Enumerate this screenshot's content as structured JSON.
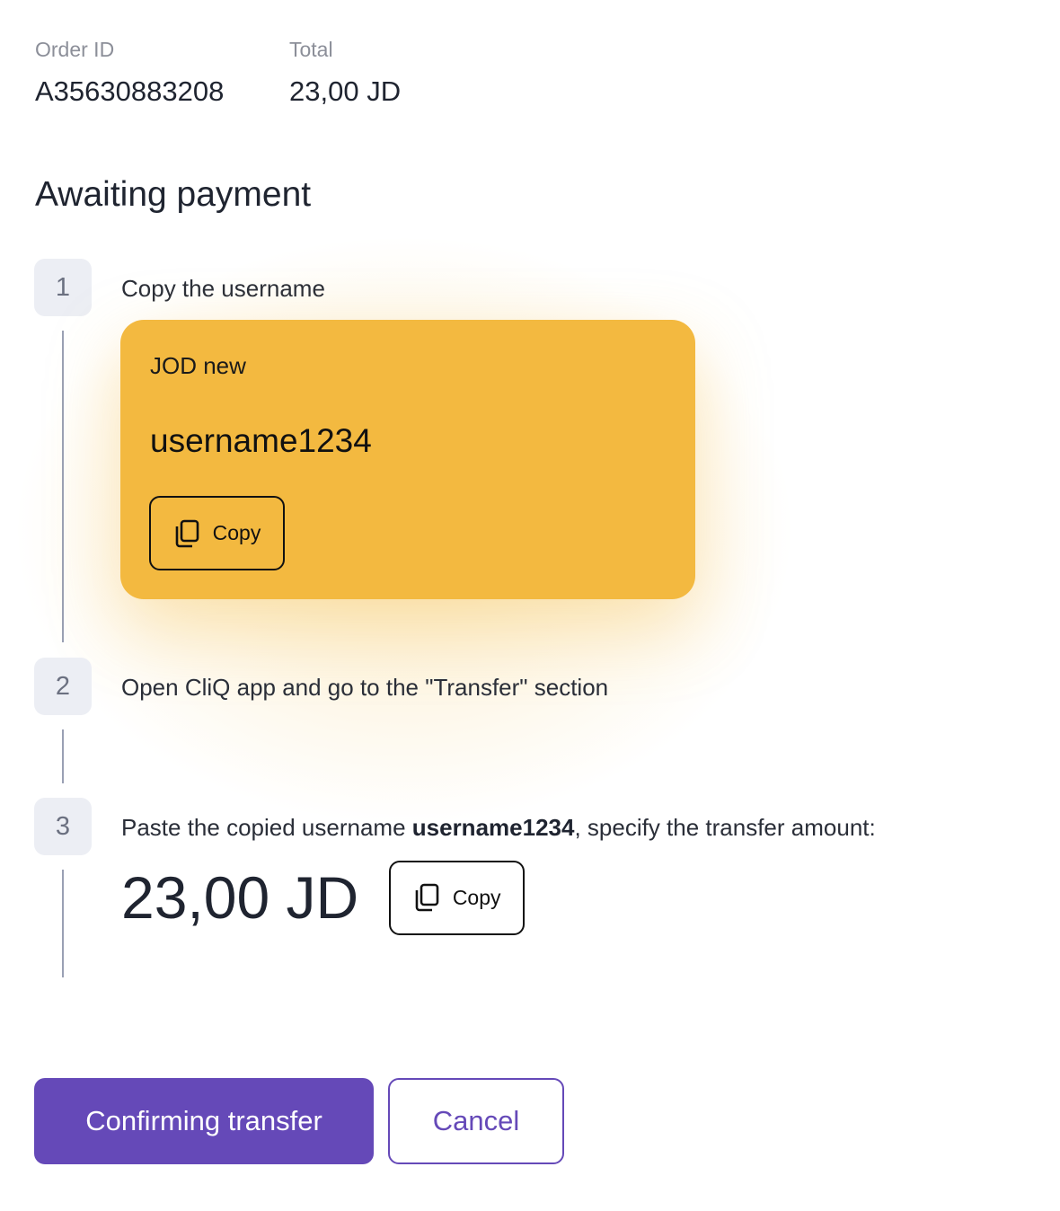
{
  "order": {
    "order_id_label": "Order ID",
    "order_id_value": "A35630883208",
    "total_label": "Total",
    "total_value": "23,00 JD"
  },
  "page_title": "Awaiting payment",
  "steps": [
    {
      "number": "1",
      "text": "Copy the username"
    },
    {
      "number": "2",
      "text": "Open CliQ app and go to the \"Transfer\" section"
    },
    {
      "number": "3",
      "text_before": "Paste the copied username ",
      "text_bold": "username1234",
      "text_after": ", specify the transfer amount:"
    }
  ],
  "card": {
    "bank_name": "JOD new",
    "username": "username1234",
    "copy_label": "Copy",
    "copy_icon": "copy-icon",
    "color": "#f3b940"
  },
  "amount": {
    "value": "23,00 JD",
    "copy_label": "Copy",
    "copy_icon": "copy-icon"
  },
  "actions": {
    "confirm_label": "Confirming transfer",
    "cancel_label": "Cancel",
    "accent_color": "#6549b8"
  }
}
